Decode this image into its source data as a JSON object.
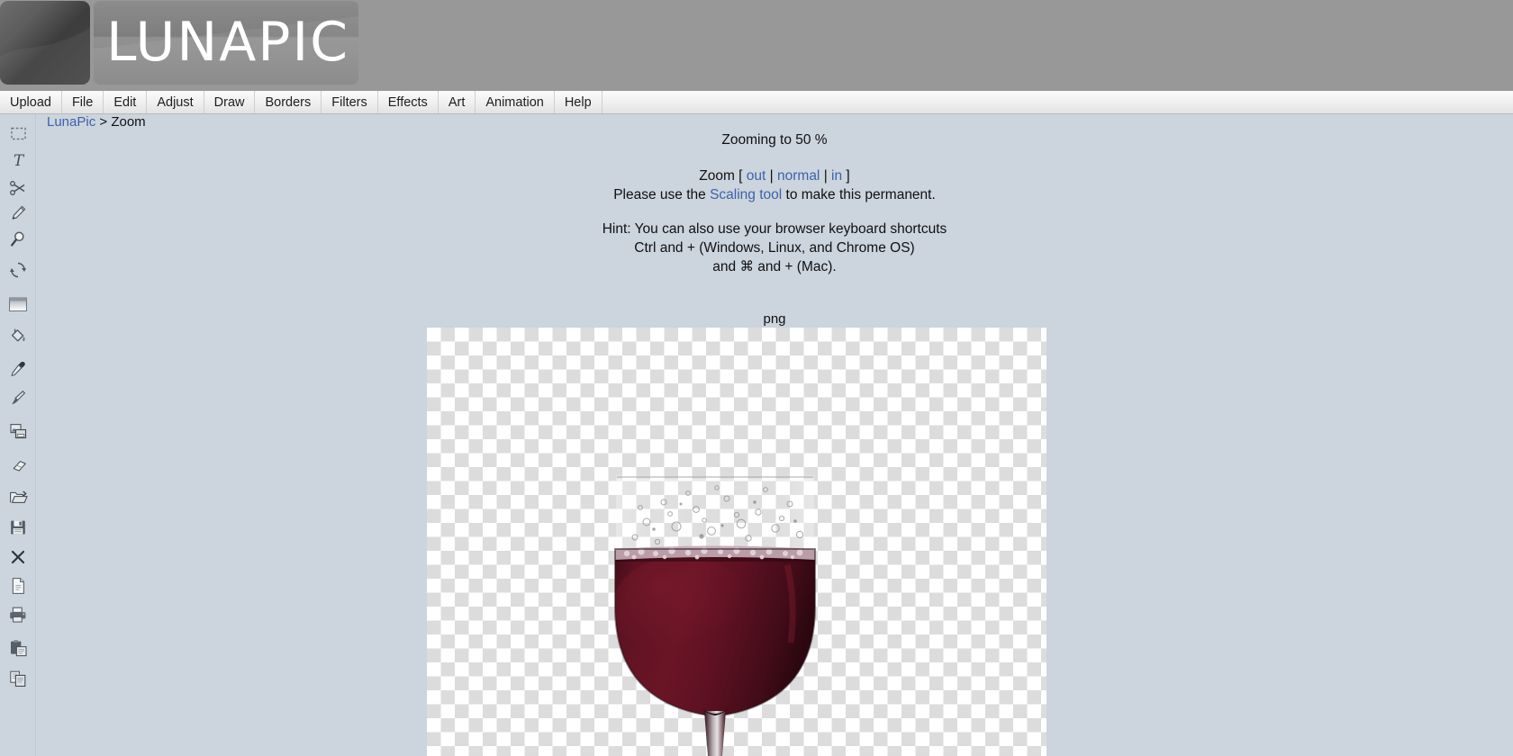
{
  "app": {
    "name": "LUNAPIC",
    "logo_icon": "crescent-moon-icon"
  },
  "menubar": {
    "items": [
      {
        "label": "Upload"
      },
      {
        "label": "File"
      },
      {
        "label": "Edit"
      },
      {
        "label": "Adjust"
      },
      {
        "label": "Draw"
      },
      {
        "label": "Borders"
      },
      {
        "label": "Filters"
      },
      {
        "label": "Effects"
      },
      {
        "label": "Art"
      },
      {
        "label": "Animation"
      },
      {
        "label": "Help"
      }
    ]
  },
  "toolbar": {
    "tools": [
      {
        "name": "marquee-select-icon",
        "title": "Select"
      },
      {
        "name": "text-tool-icon",
        "title": "Text"
      },
      {
        "name": "scissors-icon",
        "title": "Cut"
      },
      {
        "name": "pencil-icon",
        "title": "Pencil"
      },
      {
        "name": "magnifier-icon",
        "title": "Zoom"
      },
      {
        "name": "rotate-icon",
        "title": "Rotate"
      },
      {
        "name": "gradient-icon",
        "title": "Gradient"
      },
      {
        "name": "paint-bucket-icon",
        "title": "Fill"
      },
      {
        "name": "eyedropper-icon",
        "title": "Color Picker"
      },
      {
        "name": "paintbrush-icon",
        "title": "Brush"
      },
      {
        "name": "clone-stamp-icon",
        "title": "Clone"
      },
      {
        "name": "eraser-icon",
        "title": "Eraser"
      },
      {
        "name": "open-folder-icon",
        "title": "Open"
      },
      {
        "name": "save-floppy-icon",
        "title": "Save"
      },
      {
        "name": "close-x-icon",
        "title": "Close"
      },
      {
        "name": "new-document-icon",
        "title": "New"
      },
      {
        "name": "printer-icon",
        "title": "Print"
      },
      {
        "name": "clipboard-paste-icon",
        "title": "Paste"
      },
      {
        "name": "copy-pages-icon",
        "title": "Copy"
      }
    ]
  },
  "breadcrumb": {
    "home": "LunaPic",
    "separator": " > ",
    "current": "Zoom"
  },
  "main": {
    "zoom_status": "Zooming to 50 %",
    "zoom_prefix": "Zoom [ ",
    "zoom_out": "out",
    "sep1": " | ",
    "zoom_normal": "normal",
    "sep2": " | ",
    "zoom_in": "in",
    "zoom_suffix": " ]",
    "scaling_prefix": "Please use the ",
    "scaling_link": "Scaling tool",
    "scaling_suffix": " to make this permanent.",
    "hint_line1": "Hint: You can also use your browser keyboard shortcuts",
    "hint_line2": "Ctrl and + (Windows, Linux, and Chrome OS)",
    "hint_line3": "and ⌘ and + (Mac).",
    "format_label": "png",
    "zoom_percent": "50"
  },
  "image": {
    "alt": "wine-glass-image",
    "transparent_background": true
  },
  "colors": {
    "page_background": "#ccd4de",
    "header_background": "#989898",
    "menubar_background": "#f0f0f0",
    "link_blue": "#3d63a8",
    "text_black": "#101010",
    "wine_burgundy": "#5a1020",
    "checker_light": "#ffffff",
    "checker_dark": "#dcdcdc"
  }
}
